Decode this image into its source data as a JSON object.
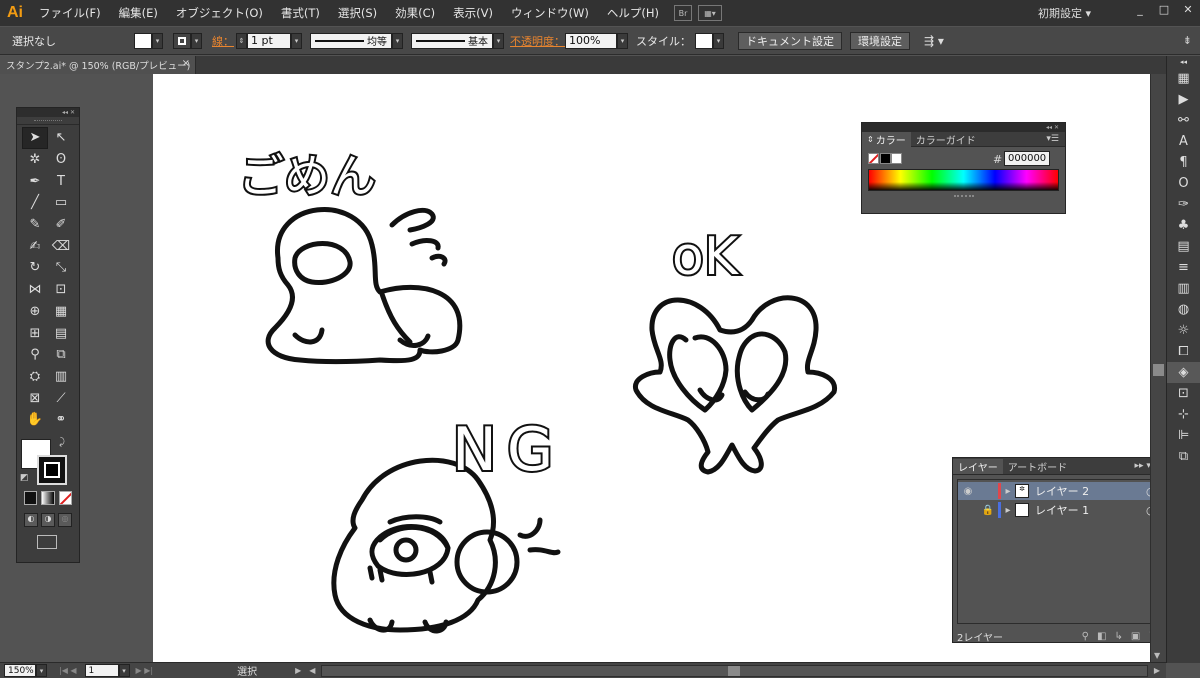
{
  "app": {
    "logo": "Ai",
    "workspace": "初期設定",
    "workspace_arrow": "▾",
    "win_min": "_",
    "win_max": "□",
    "win_close": "✕",
    "menu": [
      "ファイル(F)",
      "編集(E)",
      "オブジェクト(O)",
      "書式(T)",
      "選択(S)",
      "効果(C)",
      "表示(V)",
      "ウィンドウ(W)",
      "ヘルプ(H)"
    ],
    "bridge": "Br",
    "arrange": "▦▾"
  },
  "control": {
    "selection": "選択なし",
    "stroke_label": "線：",
    "stroke_weight": "1 pt",
    "profile_label": "均等",
    "brush_label": "基本",
    "opacity_label": "不透明度：",
    "opacity_value": "100%",
    "style_label": "スタイル：",
    "doc_setup": "ドキュメント設定",
    "preferences": "環境設定"
  },
  "document": {
    "tab_title": "スタンプ2.ai* @ 150% (RGB/プレビュー)",
    "close": "×"
  },
  "status": {
    "zoom": "150%",
    "artboard": "1",
    "tool": "選択"
  },
  "color_panel": {
    "tab_color": "カラー",
    "tab_guide": "カラーガイド",
    "hash": "#",
    "hex": "000000"
  },
  "layers_panel": {
    "tab_layers": "レイヤー",
    "tab_artboards": "アートボード",
    "rows": [
      {
        "name": "レイヤー 2",
        "color": "#e0474c",
        "selected": true,
        "locked": false,
        "visible": true
      },
      {
        "name": "レイヤー 1",
        "color": "#4a6fe0",
        "selected": false,
        "locked": true,
        "visible": false
      }
    ],
    "count": "2レイヤー"
  },
  "artwork": {
    "text_gomen": "ごめん",
    "text_ok": "oK",
    "text_ng": "NG"
  }
}
